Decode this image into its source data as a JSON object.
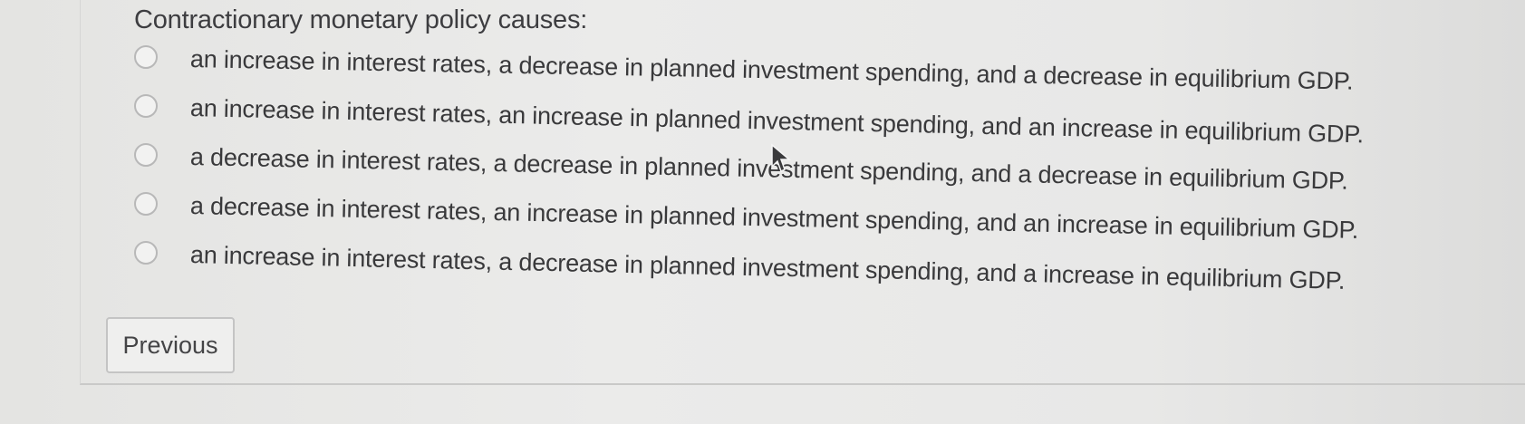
{
  "question": {
    "text": "Contractionary monetary policy causes:"
  },
  "options": [
    {
      "label": "an increase in interest rates, a decrease in planned investment spending, and a decrease in equilibrium GDP."
    },
    {
      "label": "an increase in interest rates, an increase in planned investment spending, and an increase in equilibrium GDP."
    },
    {
      "label": "a decrease in interest rates, a decrease in planned investment spending, and a decrease in equilibrium GDP."
    },
    {
      "label": "a decrease in interest rates, an increase in planned investment spending, and an increase in equilibrium GDP."
    },
    {
      "label": "an increase in interest rates, a decrease in planned investment spending, and a increase in equilibrium GDP."
    }
  ],
  "navigation": {
    "previous_label": "Previous"
  },
  "colors": {
    "background": "#e8e8e7",
    "text": "#3b3b3d",
    "radio_border": "#b8b8b8"
  },
  "icons": {
    "cursor": "mouse-pointer-icon",
    "radio": "radio-unchecked-icon"
  }
}
